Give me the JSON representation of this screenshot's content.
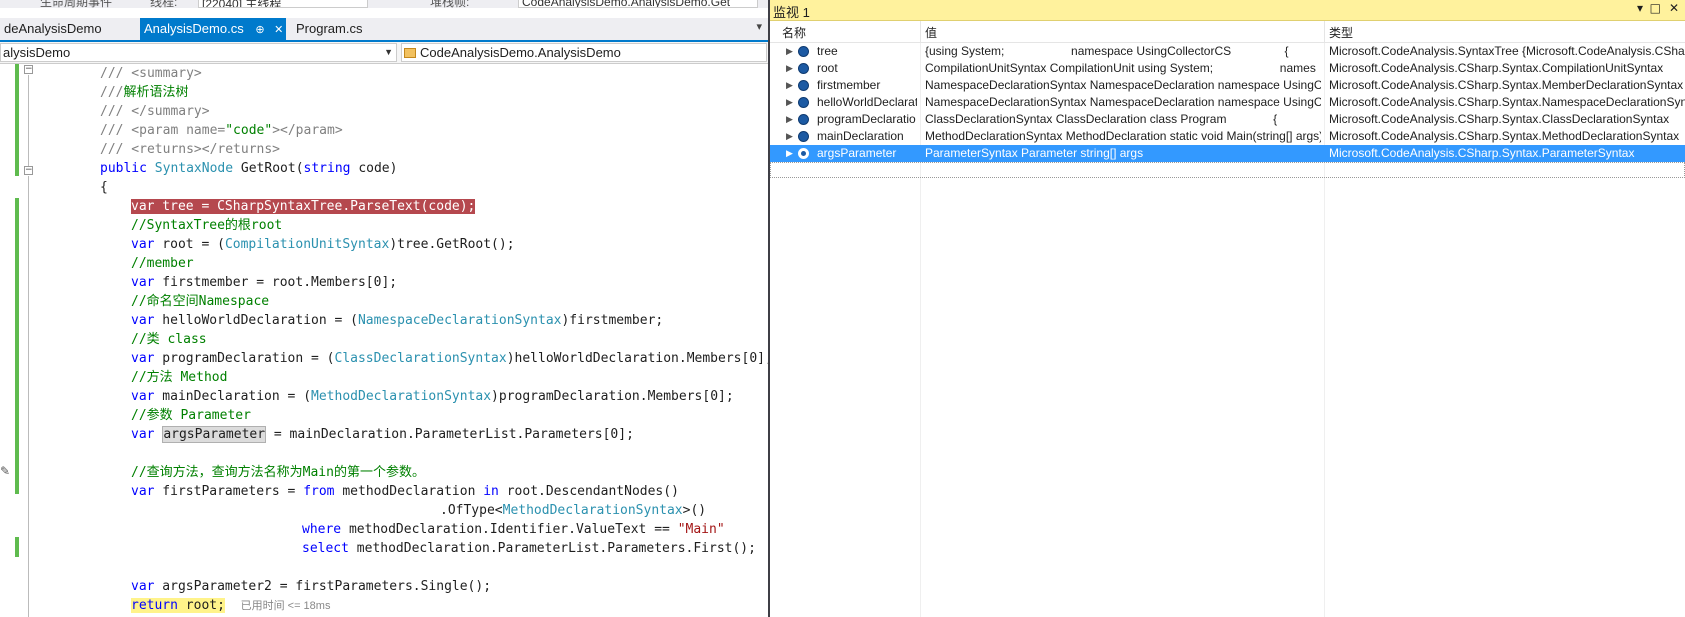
{
  "toolbar": {
    "stack_frame_label": "生命周期事件",
    "thread_label": "线程:",
    "thread_value": "[22040] 主线程",
    "stack_label": "堆栈帧:",
    "stack_value": "CodeAnalysisDemo.AnalysisDemo.Get"
  },
  "tabs": [
    {
      "label": "deAnalysisDemo"
    },
    {
      "label": "AnalysisDemo.cs",
      "pin": "⊕",
      "close": "✕"
    },
    {
      "label": "Program.cs"
    }
  ],
  "navbar": {
    "project": "alysisDemo",
    "class": "CodeAnalysisDemo.AnalysisDemo"
  },
  "code": {
    "l1": "/// <summary>",
    "l2_prefix": "///",
    "l2_text": "解析语法树",
    "l3": "/// </summary>",
    "l4_a": "/// <param name=",
    "l4_b": "\"code\"",
    "l4_c": "></param>",
    "l5": "/// <returns></returns>",
    "l6_public": "public",
    "l6_type": "SyntaxNode",
    "l6_method": "GetRoot(",
    "l6_string": "string",
    "l6_rest": "code)",
    "l7": "{",
    "l8": "var tree = CSharpSyntaxTree.ParseText(code);",
    "l9": "//SyntaxTree的根root",
    "l10_var": "var",
    "l10_a": " root = (",
    "l10_type": "CompilationUnitSyntax",
    "l10_b": ")tree.GetRoot();",
    "l11": "//member",
    "l12_var": "var",
    "l12_a": " firstmember = root.Members[0];",
    "l13": "//命名空间Namespace",
    "l14_var": "var",
    "l14_a": " helloWorldDeclaration = (",
    "l14_type": "NamespaceDeclarationSyntax",
    "l14_b": ")firstmember;",
    "l15": "//类 class",
    "l16_var": "var",
    "l16_a": " programDeclaration = (",
    "l16_type": "ClassDeclarationSyntax",
    "l16_b": ")helloWorldDeclaration.Members[0];",
    "l17": "//方法 Method",
    "l18_var": "var",
    "l18_a": " mainDeclaration = (",
    "l18_type": "MethodDeclarationSyntax",
    "l18_b": ")programDeclaration.Members[0];",
    "l19": "//参数 Parameter",
    "l20_var": "var",
    "l20_ref": "argsParameter",
    "l20_b": " = mainDeclaration.ParameterList.Parameters[0];",
    "l22": "//查询方法，查询方法名称为Main的第一个参数。",
    "l23_var": "var",
    "l23_a": " firstParameters = ",
    "l23_from": "from",
    "l23_b": " methodDeclaration ",
    "l23_in": "in",
    "l23_c": " root.DescendantNodes()",
    "l24_a": ".OfType<",
    "l24_type": "MethodDeclarationSyntax",
    "l24_b": ">()",
    "l25_where": "where",
    "l25_a": " methodDeclaration.Identifier.ValueText == ",
    "l25_str": "\"Main\"",
    "l26_select": "select",
    "l26_a": " methodDeclaration.ParameterList.Parameters.First();",
    "l28_var": "var",
    "l28_a": " argsParameter2 = firstParameters.Single();",
    "l29_return": "return",
    "l29_a": " root;",
    "elapsed": "已用时间 <= 18ms"
  },
  "watch": {
    "title": "监视 1",
    "title_buttons": {
      "dropdown": "▾",
      "maximize": "□",
      "close": "✕"
    },
    "columns": {
      "name": "名称",
      "value": "值",
      "type": "类型"
    },
    "rows": [
      {
        "name": "tree",
        "value": "{using System;                    namespace UsingCollectorCS                {",
        "type": "Microsoft.CodeAnalysis.SyntaxTree {Microsoft.CodeAnalysis.CSharp"
      },
      {
        "name": "root",
        "value": "CompilationUnitSyntax CompilationUnit using System;                    names",
        "type": "Microsoft.CodeAnalysis.CSharp.Syntax.CompilationUnitSyntax"
      },
      {
        "name": "firstmember",
        "value": "NamespaceDeclarationSyntax NamespaceDeclaration namespace UsingColl",
        "type": "Microsoft.CodeAnalysis.CSharp.Syntax.MemberDeclarationSyntax {"
      },
      {
        "name": "helloWorldDeclarat",
        "value": "NamespaceDeclarationSyntax NamespaceDeclaration namespace UsingColl",
        "type": "Microsoft.CodeAnalysis.CSharp.Syntax.NamespaceDeclarationSynt"
      },
      {
        "name": "programDeclaratio",
        "value": "ClassDeclarationSyntax ClassDeclaration class Program              {",
        "type": "Microsoft.CodeAnalysis.CSharp.Syntax.ClassDeclarationSyntax"
      },
      {
        "name": "mainDeclaration",
        "value": "MethodDeclarationSyntax MethodDeclaration static void Main(string[] args)",
        "type": "Microsoft.CodeAnalysis.CSharp.Syntax.MethodDeclarationSyntax"
      },
      {
        "name": "argsParameter",
        "value": "ParameterSyntax Parameter string[] args",
        "type": "Microsoft.CodeAnalysis.CSharp.Syntax.ParameterSyntax"
      }
    ]
  },
  "colors": {
    "accent": "#007acc",
    "watch_title": "#fff29d",
    "selection": "#3399ff",
    "breakpoint_highlight": "#b5484e",
    "current_statement": "#fff38a"
  }
}
